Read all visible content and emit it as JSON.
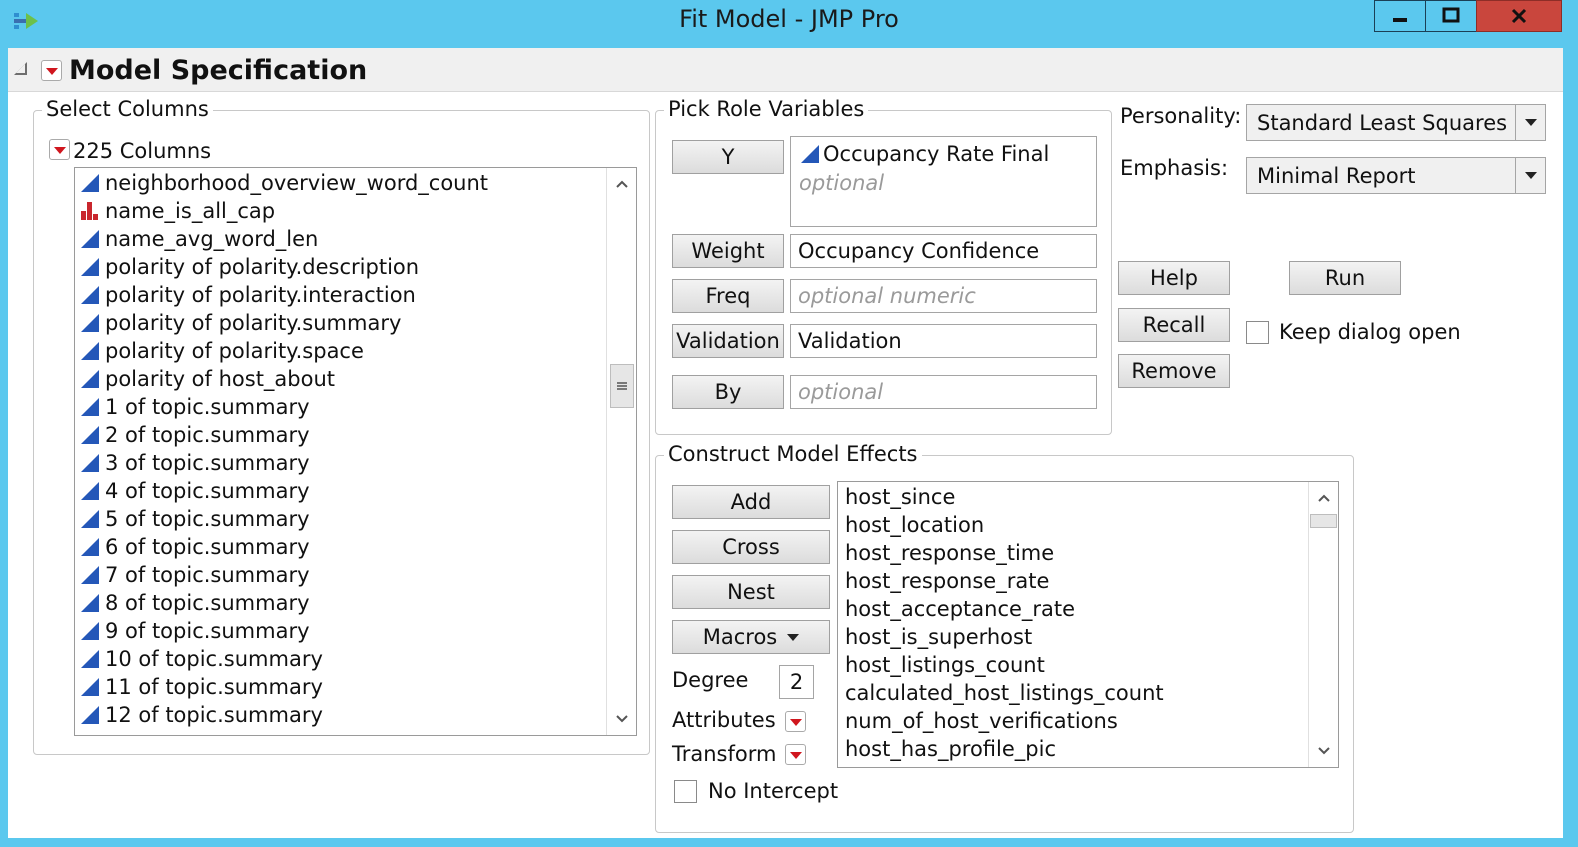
{
  "window": {
    "title": "Fit Model - JMP Pro",
    "icon": "jmp-app-icon"
  },
  "outline": {
    "title": "Model Specification"
  },
  "select_columns": {
    "label": "Select Columns",
    "count_label": "225 Columns",
    "items": [
      {
        "name": "neighborhood_overview_word_count",
        "type": "continuous"
      },
      {
        "name": "name_is_all_cap",
        "type": "nominal"
      },
      {
        "name": "name_avg_word_len",
        "type": "continuous"
      },
      {
        "name": "polarity of polarity.description",
        "type": "continuous"
      },
      {
        "name": "polarity of polarity.interaction",
        "type": "continuous"
      },
      {
        "name": "polarity of polarity.summary",
        "type": "continuous"
      },
      {
        "name": "polarity of polarity.space",
        "type": "continuous"
      },
      {
        "name": "polarity of host_about",
        "type": "continuous"
      },
      {
        "name": "1 of topic.summary",
        "type": "continuous"
      },
      {
        "name": "2 of topic.summary",
        "type": "continuous"
      },
      {
        "name": "3 of topic.summary",
        "type": "continuous"
      },
      {
        "name": "4 of topic.summary",
        "type": "continuous"
      },
      {
        "name": "5 of topic.summary",
        "type": "continuous"
      },
      {
        "name": "6 of topic.summary",
        "type": "continuous"
      },
      {
        "name": "7 of topic.summary",
        "type": "continuous"
      },
      {
        "name": "8 of topic.summary",
        "type": "continuous"
      },
      {
        "name": "9 of topic.summary",
        "type": "continuous"
      },
      {
        "name": "10 of topic.summary",
        "type": "continuous"
      },
      {
        "name": "11 of topic.summary",
        "type": "continuous"
      },
      {
        "name": "12 of topic.summary",
        "type": "continuous"
      }
    ]
  },
  "pick_roles": {
    "label": "Pick Role Variables",
    "y": {
      "button": "Y",
      "value": "Occupancy Rate Final",
      "placeholder": "optional"
    },
    "weight": {
      "button": "Weight",
      "value": "Occupancy Confidence"
    },
    "freq": {
      "button": "Freq",
      "placeholder": "optional numeric"
    },
    "validation": {
      "button": "Validation",
      "value": "Validation"
    },
    "by": {
      "button": "By",
      "placeholder": "optional"
    }
  },
  "personality": {
    "label": "Personality:",
    "value": "Standard Least Squares"
  },
  "emphasis": {
    "label": "Emphasis:",
    "value": "Minimal Report"
  },
  "actions": {
    "help": "Help",
    "run": "Run",
    "recall": "Recall",
    "remove": "Remove",
    "keep_open": "Keep dialog open"
  },
  "effects": {
    "label": "Construct Model Effects",
    "add": "Add",
    "cross": "Cross",
    "nest": "Nest",
    "macros": "Macros",
    "degree_label": "Degree",
    "degree_value": "2",
    "attributes_label": "Attributes",
    "transform_label": "Transform",
    "no_intercept": "No Intercept",
    "items": [
      "host_since",
      "host_location",
      "host_response_time",
      "host_response_rate",
      "host_acceptance_rate",
      "host_is_superhost",
      "host_listings_count",
      "calculated_host_listings_count",
      "num_of_host_verifications",
      "host_has_profile_pic"
    ]
  }
}
